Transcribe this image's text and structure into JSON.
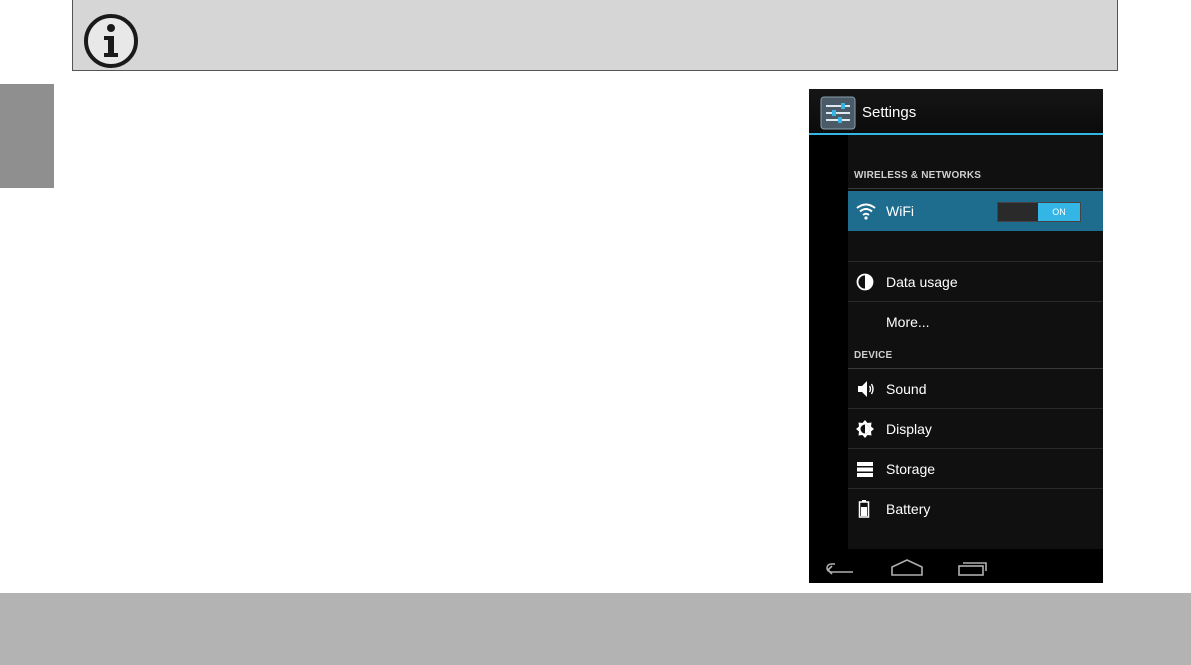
{
  "phone": {
    "title": "Settings",
    "sections": [
      {
        "header": "WIRELESS & NETWORKS"
      },
      {
        "header": "DEVICE"
      }
    ],
    "items": [
      {
        "label": "WiFi",
        "icon": "wifi-icon",
        "toggle": "ON",
        "selected": true
      },
      {
        "label": "Data usage",
        "icon": "data-usage-icon"
      },
      {
        "label": "More...",
        "icon": ""
      },
      {
        "label": "Sound",
        "icon": "sound-icon"
      },
      {
        "label": "Display",
        "icon": "display-icon"
      },
      {
        "label": "Storage",
        "icon": "storage-icon"
      },
      {
        "label": "Battery",
        "icon": "battery-icon"
      }
    ],
    "nav": [
      "back-icon",
      "home-icon",
      "recent-apps-icon"
    ]
  },
  "colors": {
    "accent": "#33b5e5",
    "selected_row": "#1e6d8f",
    "note_bar": "#d6d6d6",
    "side_tab": "#8f8f8f",
    "footer_bar": "#b3b3b3"
  }
}
